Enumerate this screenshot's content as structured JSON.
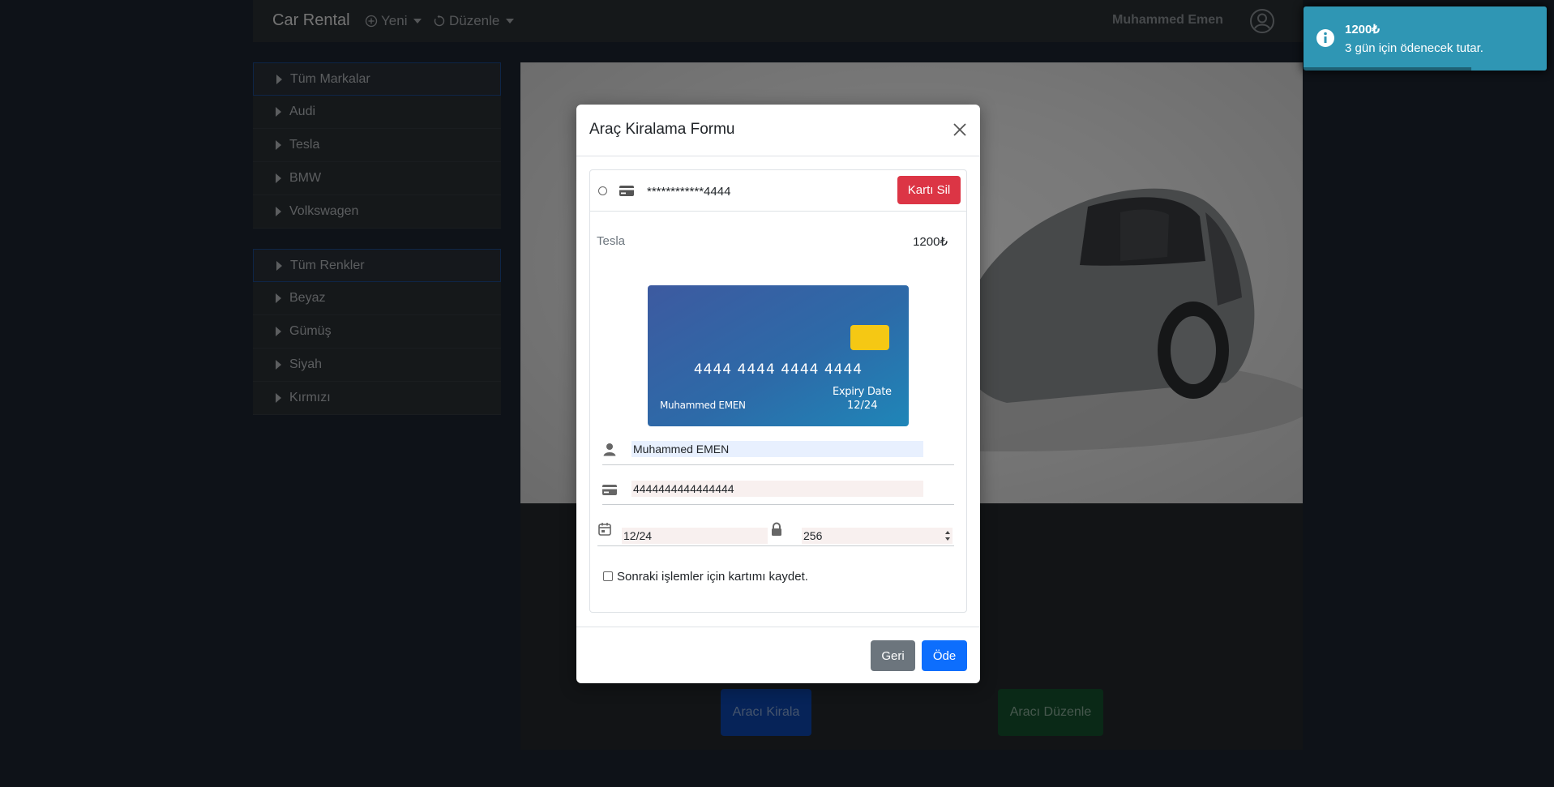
{
  "navbar": {
    "brand": "Car Rental",
    "new_menu": "Yeni",
    "edit_menu": "Düzenle",
    "user_name": "Muhammed Emen"
  },
  "brands": {
    "header": "Tüm Markalar",
    "items": [
      "Audi",
      "Tesla",
      "BMW",
      "Volkswagen"
    ]
  },
  "colors_list": {
    "header": "Tüm Renkler",
    "items": [
      "Beyaz",
      "Gümüş",
      "Siyah",
      "Kırmızı"
    ]
  },
  "car_actions": {
    "rent_label": "Aracı Kirala",
    "edit_label": "Aracı Düzenle"
  },
  "modal": {
    "title": "Araç Kiralama Formu",
    "saved_card_masked": "************4444",
    "delete_card_label": "Kartı Sil",
    "car_name": "Tesla",
    "car_price": "1200₺",
    "card_preview": {
      "number": "4444 4444 4444 4444",
      "holder": "Muhammed EMEN",
      "expiry_label": "Expiry Date",
      "expiry": "12/24"
    },
    "fields": {
      "name_value": "Muhammed EMEN",
      "number_value": "4444444444444444",
      "expiry_value": "12/24",
      "cvv_value": "256"
    },
    "save_card_label": "Sonraki işlemler için kartımı kaydet.",
    "save_card_checked": false,
    "back_label": "Geri",
    "pay_label": "Öde"
  },
  "toast": {
    "title": "1200₺",
    "message": "3 gün için ödenecek tutar.",
    "progress": 0.69
  },
  "colors": {
    "background": "#1c2431",
    "navbar": "#2b3035",
    "primary": "#0d6efd",
    "danger": "#dc3545",
    "secondary": "#6c757d",
    "success": "#198754",
    "info_toast": "#2f96b4",
    "card_chip": "#f5c814"
  }
}
